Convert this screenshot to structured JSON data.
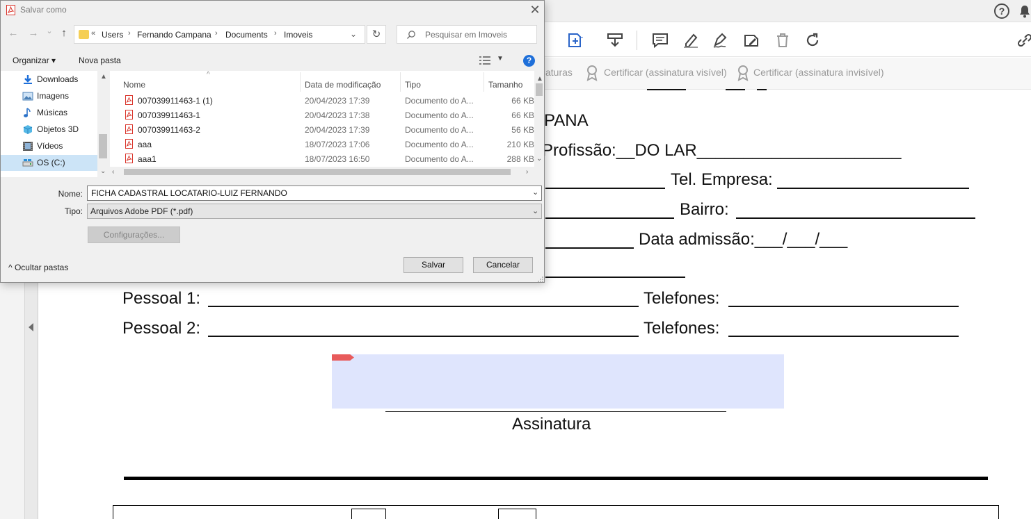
{
  "dialog": {
    "title": "Salvar como",
    "close_glyph": "✕",
    "nav": {
      "back": "←",
      "forward": "→",
      "recent": "⌄",
      "up": "↑"
    },
    "address": {
      "overflow": "«",
      "crumbs": [
        "Users",
        "Fernando Campana",
        "Documents",
        "Imoveis"
      ],
      "dropdown": "⌄",
      "refresh": "↻"
    },
    "search": {
      "placeholder": "Pesquisar em Imoveis"
    },
    "commands": {
      "organize": "Organizar ▾",
      "new_folder": "Nova pasta",
      "help": "?"
    },
    "nav_pane": [
      {
        "label": "Downloads",
        "icon": "download-icon"
      },
      {
        "label": "Imagens",
        "icon": "images-icon"
      },
      {
        "label": "Músicas",
        "icon": "music-icon"
      },
      {
        "label": "Objetos 3D",
        "icon": "cube-icon"
      },
      {
        "label": "Vídeos",
        "icon": "video-icon"
      },
      {
        "label": "OS (C:)",
        "icon": "drive-icon",
        "selected": true
      }
    ],
    "columns": {
      "name": "Nome",
      "modified": "Data de modificação",
      "type": "Tipo",
      "size": "Tamanho"
    },
    "files": [
      {
        "name": "007039911463-1 (1)",
        "modified": "20/04/2023 17:39",
        "type": "Documento do A...",
        "size": "66 KB"
      },
      {
        "name": "007039911463-1",
        "modified": "20/04/2023 17:38",
        "type": "Documento do A...",
        "size": "66 KB"
      },
      {
        "name": "007039911463-2",
        "modified": "20/04/2023 17:39",
        "type": "Documento do A...",
        "size": "56 KB"
      },
      {
        "name": "aaa",
        "modified": "18/07/2023 17:06",
        "type": "Documento do A...",
        "size": "210 KB"
      },
      {
        "name": "aaa1",
        "modified": "18/07/2023 16:50",
        "type": "Documento do A...",
        "size": "288 KB"
      }
    ],
    "form": {
      "name_label": "Nome:",
      "name_value": "FICHA CADASTRAL LOCATARIO-LUIZ FERNANDO",
      "type_label": "Tipo:",
      "type_value": "Arquivos Adobe PDF (*.pdf)",
      "settings": "Configurações...",
      "hide_folders": "^ Ocultar pastas",
      "save": "Salvar",
      "cancel": "Cancelar"
    }
  },
  "app": {
    "help_glyph": "?",
    "signature_bar": {
      "partial": "aturas",
      "certify_visible": "Certificar (assinatura visível)",
      "certify_invisible": "Certificar (assinatura invisível)"
    },
    "document": {
      "line_pana": "PANA",
      "line_profissao": "Profissão:__DO LAR______________________",
      "tel_empresa": "Tel. Empresa:",
      "bairro": "Bairro:",
      "data_admissao": "Data admissão:___/___/___",
      "pessoal1": "Pessoal 1:",
      "pessoal2": "Pessoal 2:",
      "telefones1": "Telefones:",
      "telefones2": "Telefones:",
      "assinatura": "Assinatura"
    }
  },
  "colors": {
    "accent": "#1e6fd9",
    "selection": "#cce4f7",
    "signature_field": "#dfe5fd",
    "pdf_red": "#d9342b"
  }
}
